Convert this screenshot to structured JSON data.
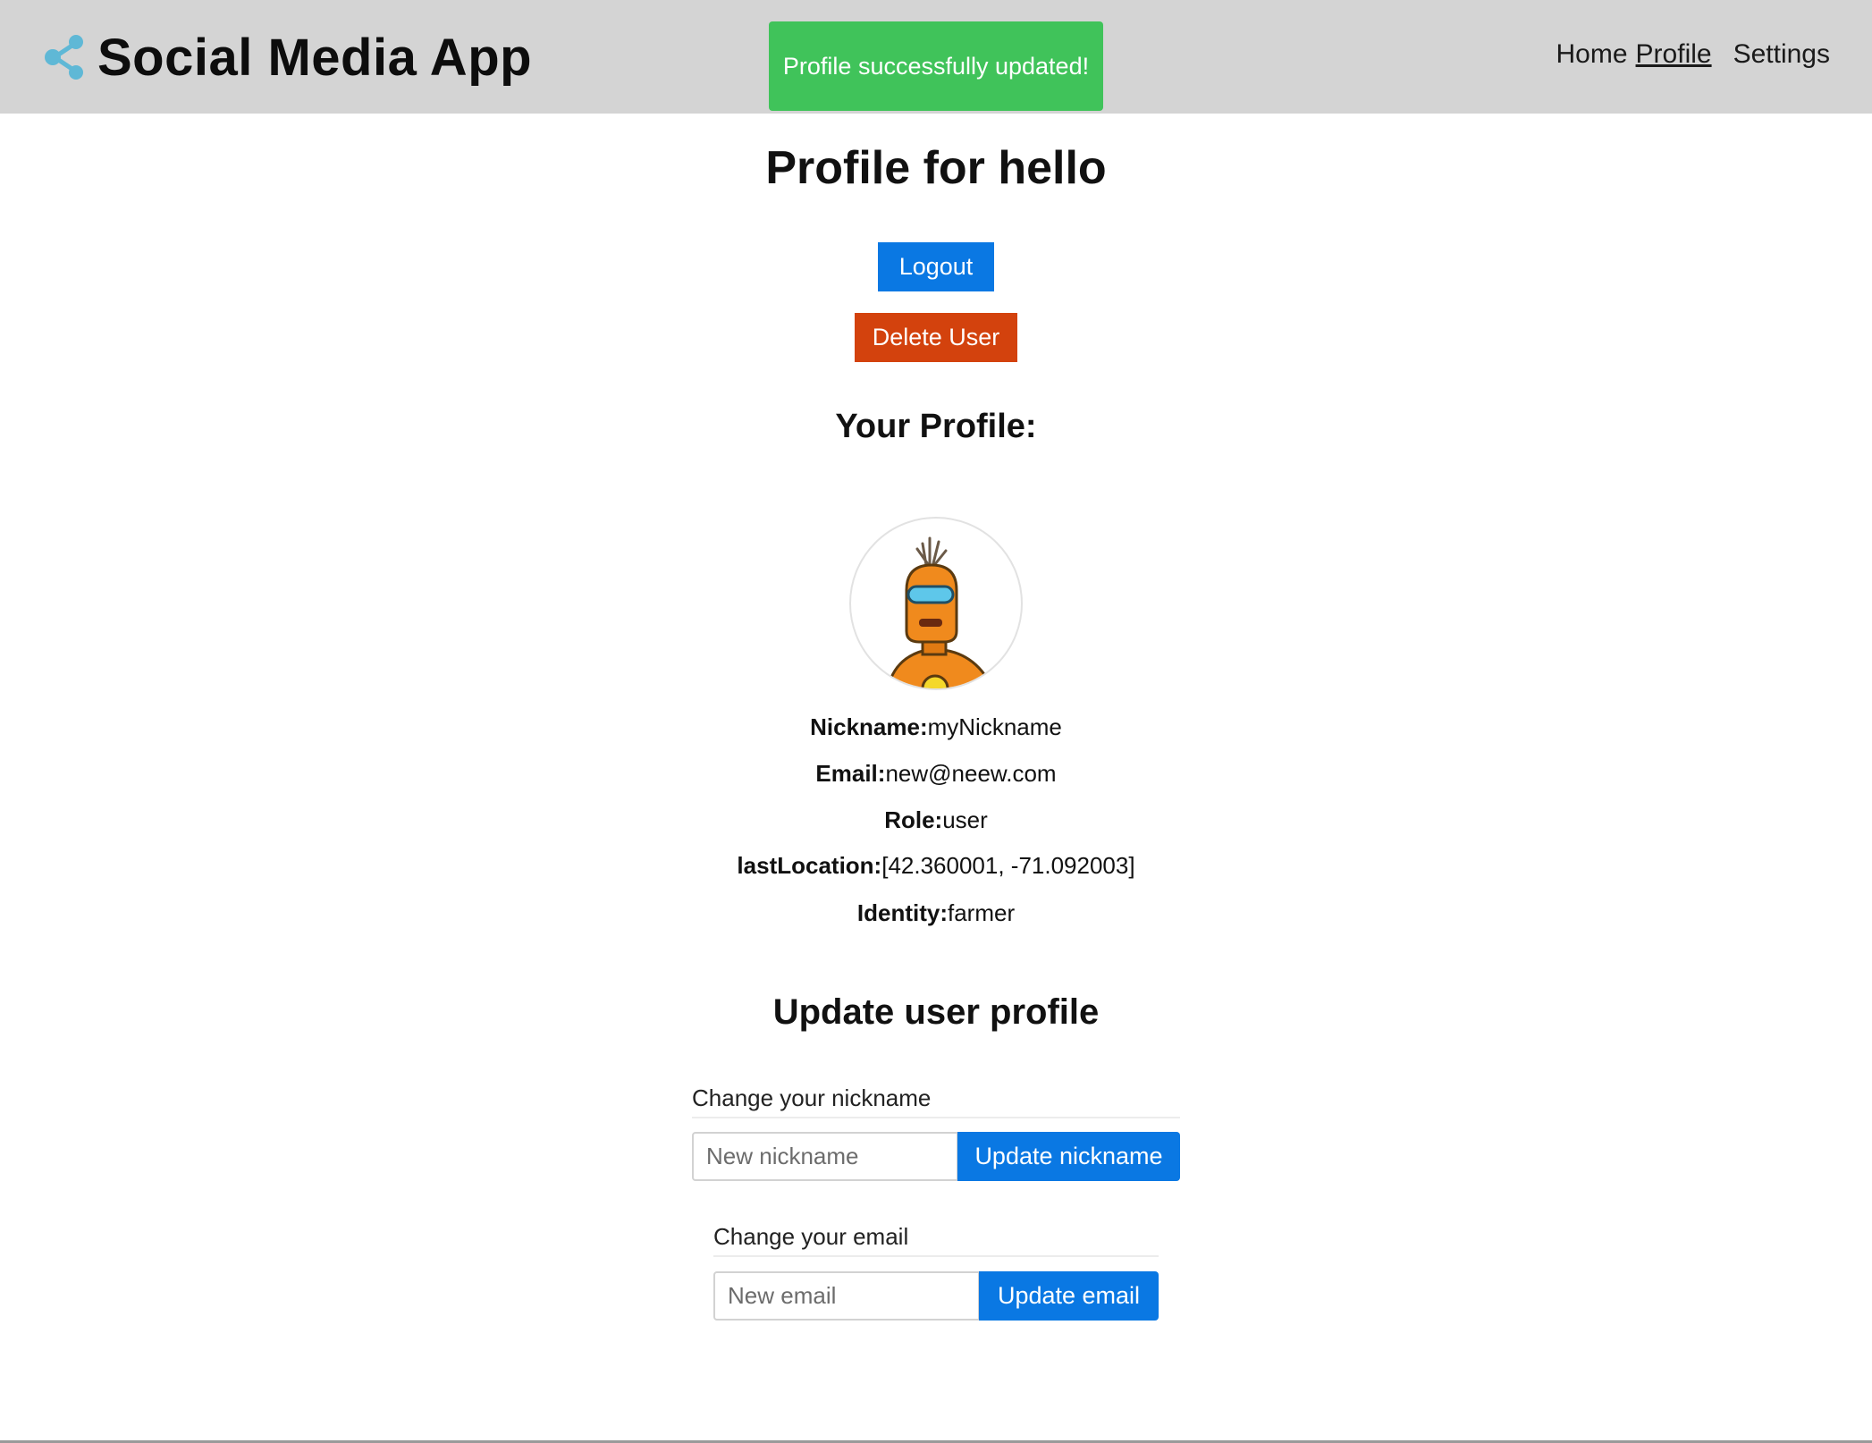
{
  "header": {
    "brand_title": "Social Media App",
    "brand_icon": "share-icon",
    "nav": {
      "home": "Home",
      "profile": "Profile",
      "settings": "Settings"
    },
    "toast": "Profile successfully updated!"
  },
  "main": {
    "title": "Profile for hello",
    "logout_label": "Logout",
    "delete_label": "Delete User",
    "your_profile_title": "Your Profile:",
    "avatar_icon": "robot-avatar-icon",
    "fields": [
      {
        "label": "Nickname:",
        "value": "myNickname"
      },
      {
        "label": "Email:",
        "value": "new@neew.com"
      },
      {
        "label": "Role:",
        "value": "user"
      },
      {
        "label": "lastLocation:",
        "value": "[42.360001, -71.092003]"
      },
      {
        "label": "Identity:",
        "value": "farmer"
      }
    ],
    "update_title": "Update user profile",
    "nickname_form": {
      "label": "Change your nickname",
      "placeholder": "New nickname",
      "button": "Update nickname"
    },
    "email_form": {
      "label": "Change your email",
      "placeholder": "New email",
      "button": "Update email"
    }
  },
  "colors": {
    "header_bg": "#d4d4d4",
    "toast_bg": "#40c35a",
    "primary": "#0a78e3",
    "danger": "#d3420d"
  }
}
